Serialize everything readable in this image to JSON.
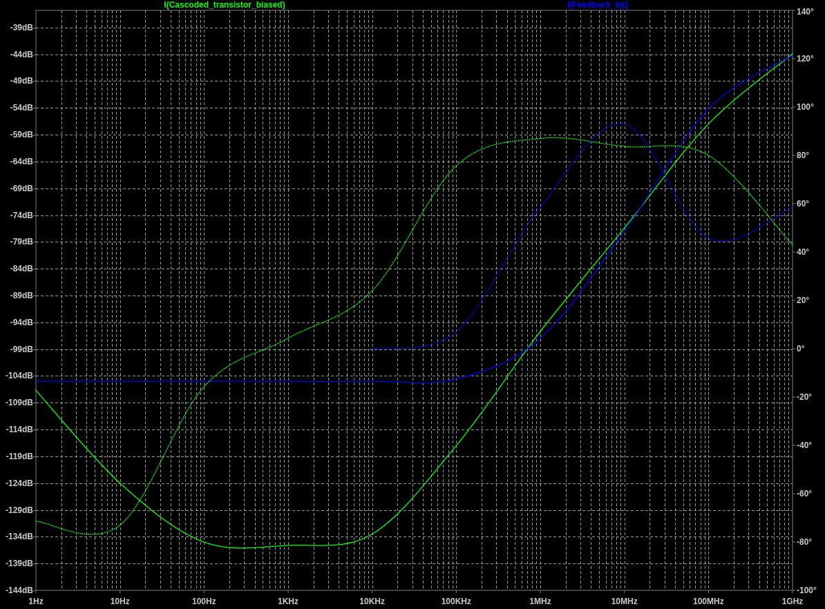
{
  "plot": {
    "magnitude": {
      "chart_data": {
        "type": "line",
        "grid": true,
        "categories": [
          "1Hz",
          "10Hz",
          "100Hz",
          "1KHz",
          "10KHz",
          "100KHz",
          "1MHz",
          "10MHz",
          "100MHz",
          "1GHz"
        ],
        "series": [
          {
            "name": "I(Cascoded_transistor_biased)",
            "color": "#00ff00",
            "line_style": "solid",
            "values": [
              -106.7,
              -124,
              -135,
              -135.6,
              -133.5,
              -117,
              -95.7,
              -76.4,
              -57,
              -43.9
            ]
          },
          {
            "name": "I(Feedback_bjt)",
            "color": "#0000ff",
            "line_style": "solid",
            "values": [
              -105,
              -105,
              -105,
              -105,
              -105,
              -104.6,
              -97,
              -77,
              -54.2,
              -44.2
            ]
          }
        ],
        "ylim": [
          -144,
          -35.8
        ],
        "yticks": [
          {
            "value": -39,
            "label": "-39dB"
          },
          {
            "value": -44,
            "label": "-44dB"
          },
          {
            "value": -49,
            "label": "-49dB"
          },
          {
            "value": -54,
            "label": "-54dB"
          },
          {
            "value": -59,
            "label": "-59dB"
          },
          {
            "value": -64,
            "label": "-64dB"
          },
          {
            "value": -69,
            "label": "-69dB"
          },
          {
            "value": -74,
            "label": "-74dB"
          },
          {
            "value": -79,
            "label": "-79dB"
          },
          {
            "value": -84,
            "label": "-84dB"
          },
          {
            "value": -89,
            "label": "-89dB"
          },
          {
            "value": -94,
            "label": "-94dB"
          },
          {
            "value": -99,
            "label": "-99dB"
          },
          {
            "value": -104,
            "label": "-104dB"
          },
          {
            "value": -109,
            "label": "-109dB"
          },
          {
            "value": -114,
            "label": "-114dB"
          },
          {
            "value": -119,
            "label": "-119dB"
          },
          {
            "value": -124,
            "label": "-124dB"
          },
          {
            "value": -129,
            "label": "-129dB"
          },
          {
            "value": -134,
            "label": "-134dB"
          },
          {
            "value": -139,
            "label": "-139dB"
          },
          {
            "value": -144,
            "label": "-144dB"
          }
        ]
      }
    },
    "phase": {
      "chart_data": {
        "type": "line",
        "series": [
          {
            "color": "#00ff00",
            "line_style": "dotted",
            "values": [
              -71.4,
              -73,
              -15.7,
              4.3,
              24,
              75.7,
              87,
              83.7,
              80,
              42.9
            ]
          },
          {
            "color": "#0000ff",
            "line_style": "dotted",
            "values": [
              null,
              null,
              null,
              null,
              0,
              7,
              58.6,
              92.9,
              45.7,
              58.6
            ]
          }
        ],
        "ylim": [
          -100,
          140
        ],
        "yticks": [
          {
            "value": 140,
            "label": "140°"
          },
          {
            "value": 120,
            "label": "120°"
          },
          {
            "value": 100,
            "label": "100°"
          },
          {
            "value": 80,
            "label": "80°"
          },
          {
            "value": 60,
            "label": "60°"
          },
          {
            "value": 40,
            "label": "40°"
          },
          {
            "value": 20,
            "label": "20°"
          },
          {
            "value": 0,
            "label": "0°"
          },
          {
            "value": -20,
            "label": "-20°"
          },
          {
            "value": -40,
            "label": "-40°"
          },
          {
            "value": -60,
            "label": "-60°"
          },
          {
            "value": -80,
            "label": "-80°"
          },
          {
            "value": -100,
            "label": "-100°"
          }
        ]
      }
    }
  }
}
